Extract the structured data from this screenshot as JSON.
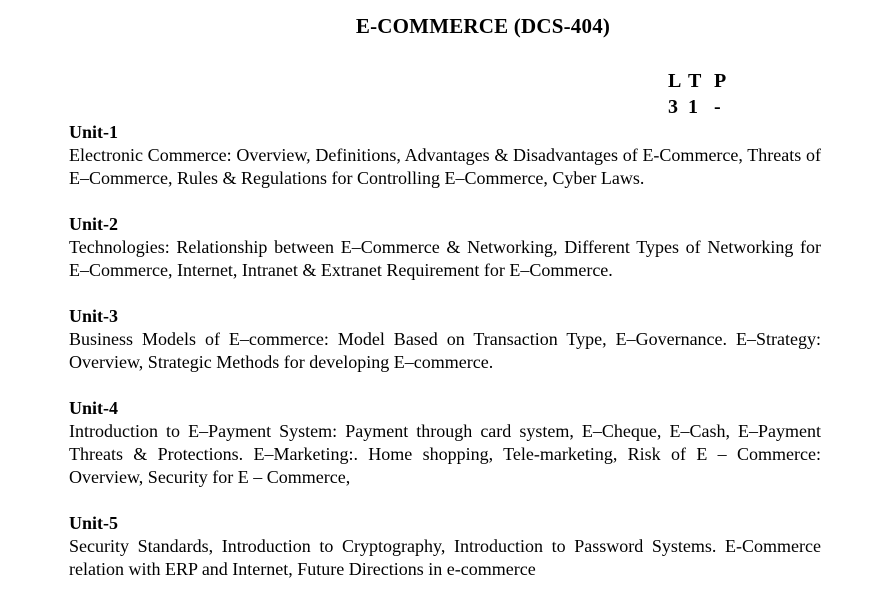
{
  "document": {
    "title": "E-COMMERCE (DCS-404)",
    "ltp": {
      "header": [
        "L",
        "T",
        "P"
      ],
      "values": [
        "3",
        "1",
        "-"
      ]
    },
    "units": [
      {
        "heading": "Unit-1",
        "body": " Electronic Commerce: Overview, Definitions, Advantages & Disadvantages of E-Commerce, Threats of E–Commerce, Rules & Regulations for Controlling E–Commerce, Cyber Laws."
      },
      {
        "heading": "Unit-2",
        "body": "Technologies: Relationship between E–Commerce & Networking, Different Types of Networking for E–Commerce, Internet, Intranet & Extranet Requirement for E–Commerce."
      },
      {
        "heading": "Unit-3",
        "body": " Business Models of E–commerce: Model Based on Transaction Type, E–Governance. E–Strategy: Overview, Strategic Methods for developing E–commerce."
      },
      {
        "heading": "Unit-4",
        "body": "Introduction to E–Payment System: Payment through card system, E–Cheque, E–Cash, E–Payment Threats & Protections.  E–Marketing:. Home shopping, Tele-marketing, Risk of E – Commerce: Overview, Security for E – Commerce,"
      },
      {
        "heading": "Unit-5",
        "body": "Security Standards, Introduction to Cryptography, Introduction to Password Systems. E-Commerce relation with ERP and Internet, Future Directions in e-commerce"
      }
    ]
  }
}
